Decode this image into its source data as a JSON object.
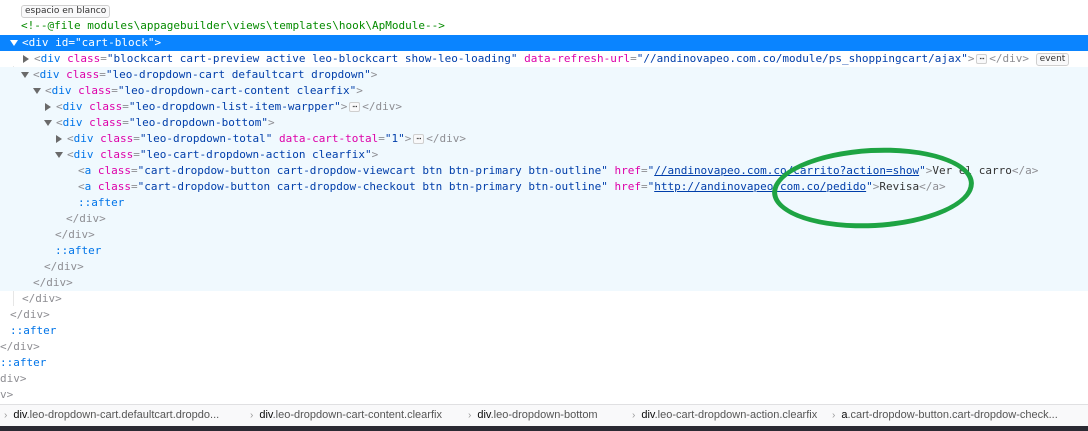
{
  "badges": {
    "whitespace": "espacio en blanco",
    "event": "event",
    "more": "⋯"
  },
  "nodes": {
    "comment": "<!--@file modules\\appagebuilder\\views\\templates\\hook\\ApModule-->",
    "cart_block": {
      "open": "<",
      "tag": "div",
      "attr": "id",
      "eq": "=",
      "value": "\"cart-block\"",
      "close": ">"
    },
    "blockcart": {
      "tag": "div",
      "attr1": "class",
      "value1": "\"blockcart cart-preview active leo-blockcart show-leo-loading\"",
      "attr2": "data-refresh-url",
      "value2": "\"//andinovapeo.com.co/module/ps_shoppingcart/ajax\"",
      "end": "</div>"
    },
    "dropdown_cart": {
      "tag": "div",
      "attr": "class",
      "value": "\"leo-dropdown-cart defaultcart dropdown\""
    },
    "dropdown_content": {
      "tag": "div",
      "attr": "class",
      "value": "\"leo-dropdown-cart-content clearfix\""
    },
    "list_wrapper": {
      "tag": "div",
      "attr": "class",
      "value": "\"leo-dropdown-list-item-warpper\"",
      "end": "</div>"
    },
    "dropdown_bottom": {
      "tag": "div",
      "attr": "class",
      "value": "\"leo-dropdown-bottom\""
    },
    "dropdown_total": {
      "tag": "div",
      "attr1": "class",
      "value1": "\"leo-dropdown-total\"",
      "attr2": "data-cart-total",
      "value2": "\"1\"",
      "end": "</div>"
    },
    "dropdown_action": {
      "tag": "div",
      "attr": "class",
      "value": "\"leo-cart-dropdown-action clearfix\""
    },
    "link_viewcart": {
      "tag": "a",
      "attr1": "class",
      "value1": "\"cart-dropdow-button cart-dropdow-viewcart btn btn-primary btn-outline\"",
      "attr2": "href",
      "q": "\"",
      "link": "//andinovapeo.com.co/carrito?action=show",
      "text": "Ver el carro",
      "end": "</a>"
    },
    "link_checkout": {
      "tag": "a",
      "attr1": "class",
      "value1": "\"cart-dropdow-button cart-dropdow-checkout btn btn-primary btn-outline\"",
      "attr2": "href",
      "q": "\"",
      "link": "http://andinovapeo.com.co/pedido",
      "text": "Revisa",
      "end": "</a>"
    },
    "after": "::after",
    "close_div": "</div>",
    "frag_div_close": "/div>",
    "frag_div": "div>",
    "frag_v": "v>"
  },
  "breadcrumbs": [
    {
      "node": "div",
      "cls": ".leo-dropdown-cart.defaultcart.dropdo..."
    },
    {
      "node": "div",
      "cls": ".leo-dropdown-cart-content.clearfix"
    },
    {
      "node": "div",
      "cls": ".leo-dropdown-bottom"
    },
    {
      "node": "div",
      "cls": ".leo-cart-dropdown-action.clearfix"
    },
    {
      "node": "a",
      "cls": ".cart-dropdow-button.cart-dropdow-check..."
    }
  ],
  "annotation": {
    "color": "#1ea443"
  }
}
